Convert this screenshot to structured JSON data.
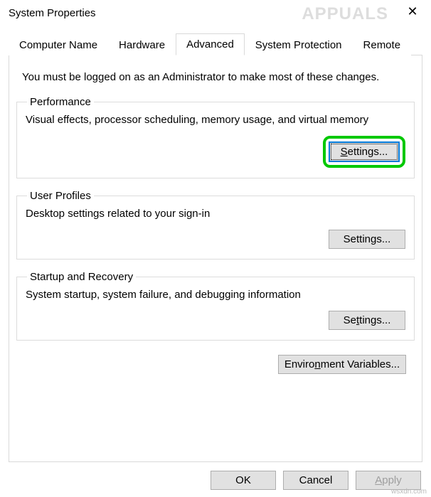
{
  "window": {
    "title": "System Properties",
    "close_glyph": "✕"
  },
  "tabs": [
    {
      "label": "Computer Name"
    },
    {
      "label": "Hardware"
    },
    {
      "label": "Advanced"
    },
    {
      "label": "System Protection"
    },
    {
      "label": "Remote"
    }
  ],
  "active_tab_index": 2,
  "admin_note": "You must be logged on as an Administrator to make most of these changes.",
  "groups": {
    "performance": {
      "legend": "Performance",
      "desc": "Visual effects, processor scheduling, memory usage, and virtual memory",
      "button_prefix": "S",
      "button_rest": "ettings..."
    },
    "user_profiles": {
      "legend": "User Profiles",
      "desc": "Desktop settings related to your sign-in",
      "button_prefix": "Settings",
      "button_rest": "..."
    },
    "startup_recovery": {
      "legend": "Startup and Recovery",
      "desc": "System startup, system failure, and debugging information",
      "button_prefix": "Se",
      "button_mn": "t",
      "button_rest": "tings..."
    }
  },
  "env_button": {
    "prefix": "Enviro",
    "mn": "n",
    "rest": "ment Variables..."
  },
  "footer": {
    "ok": "OK",
    "cancel": "Cancel",
    "apply_mn": "A",
    "apply_rest": "pply"
  },
  "watermark": "wsxdn.com",
  "credit": "APPUALS"
}
